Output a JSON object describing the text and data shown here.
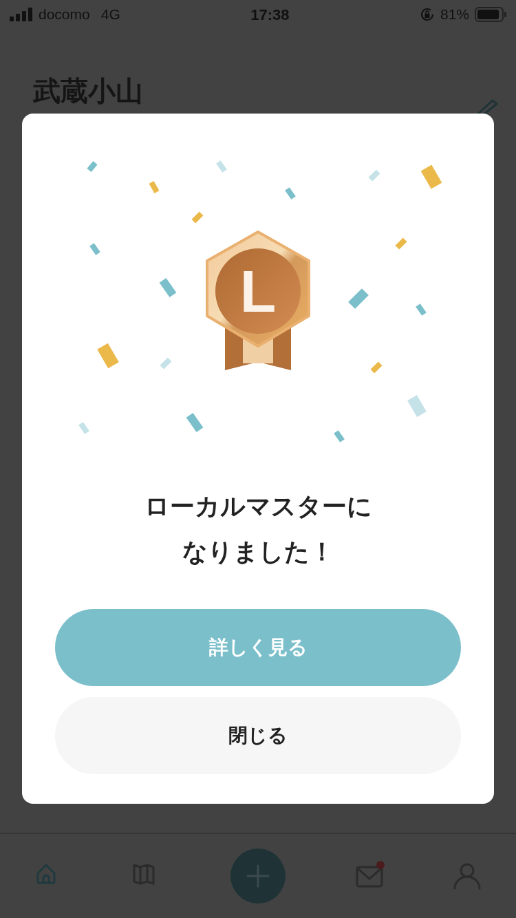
{
  "status_bar": {
    "carrier": "docomo",
    "network": "4G",
    "time": "17:38",
    "battery": "81%"
  },
  "page": {
    "title": "武蔵小山"
  },
  "modal": {
    "badge_letter": "L",
    "title": "ローカルマスターになりました！",
    "buttons": [
      {
        "label": "詳しく見る",
        "kind": "primary"
      },
      {
        "label": "閉じる",
        "kind": "secondary"
      }
    ]
  },
  "tab_bar": [
    {
      "kind": "home",
      "selected": true
    },
    {
      "kind": "map",
      "selected": false
    },
    {
      "kind": "add",
      "selected": false
    },
    {
      "kind": "mail",
      "selected": false,
      "unread": true
    },
    {
      "kind": "profile",
      "selected": false
    }
  ]
}
